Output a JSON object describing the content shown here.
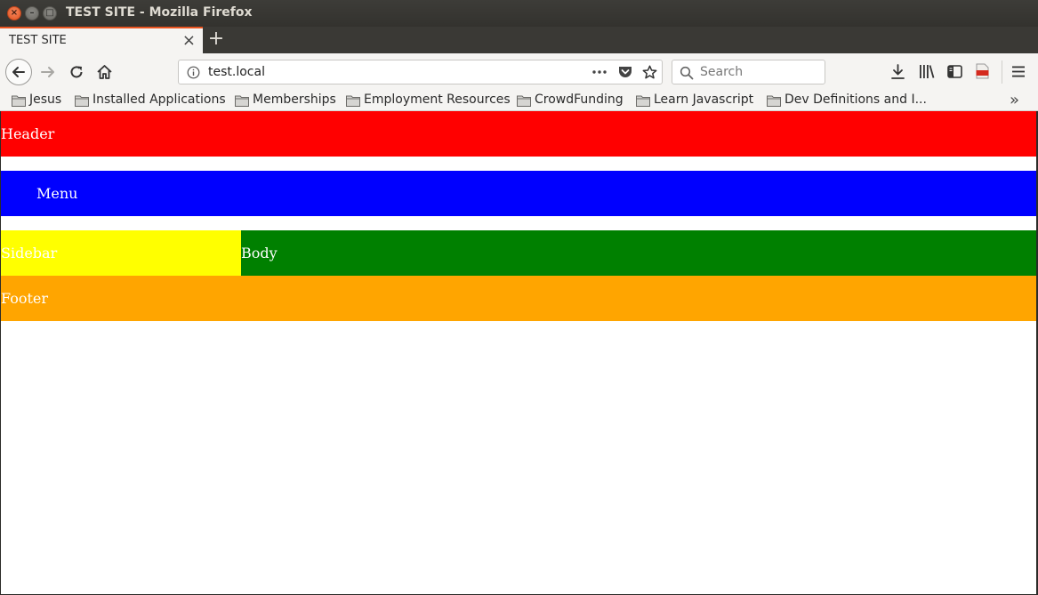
{
  "window": {
    "title": "TEST SITE - Mozilla Firefox",
    "close_glyph": "×",
    "min_glyph": "–",
    "max_glyph": "□"
  },
  "tab": {
    "label": "TEST SITE",
    "close_glyph": "×",
    "new_tab_glyph": "+"
  },
  "navbar": {
    "url": "test.local",
    "search_placeholder": "Search"
  },
  "bookmarks": {
    "items": [
      {
        "label": "Jesus"
      },
      {
        "label": "Installed Applications"
      },
      {
        "label": "Memberships"
      },
      {
        "label": "Employment Resources"
      },
      {
        "label": "CrowdFunding"
      },
      {
        "label": "Learn Javascript"
      },
      {
        "label": "Dev Definitions and I..."
      }
    ],
    "overflow_glyph": "»"
  },
  "page": {
    "header": "Header",
    "menu": "Menu",
    "sidebar": "Sidebar",
    "body": "Body",
    "footer": "Footer"
  },
  "colors": {
    "header": "#ff0000",
    "menu": "#0000ff",
    "sidebar": "#ffff00",
    "body": "#008000",
    "footer": "#ffa500",
    "tab_accent": "#e95420"
  }
}
